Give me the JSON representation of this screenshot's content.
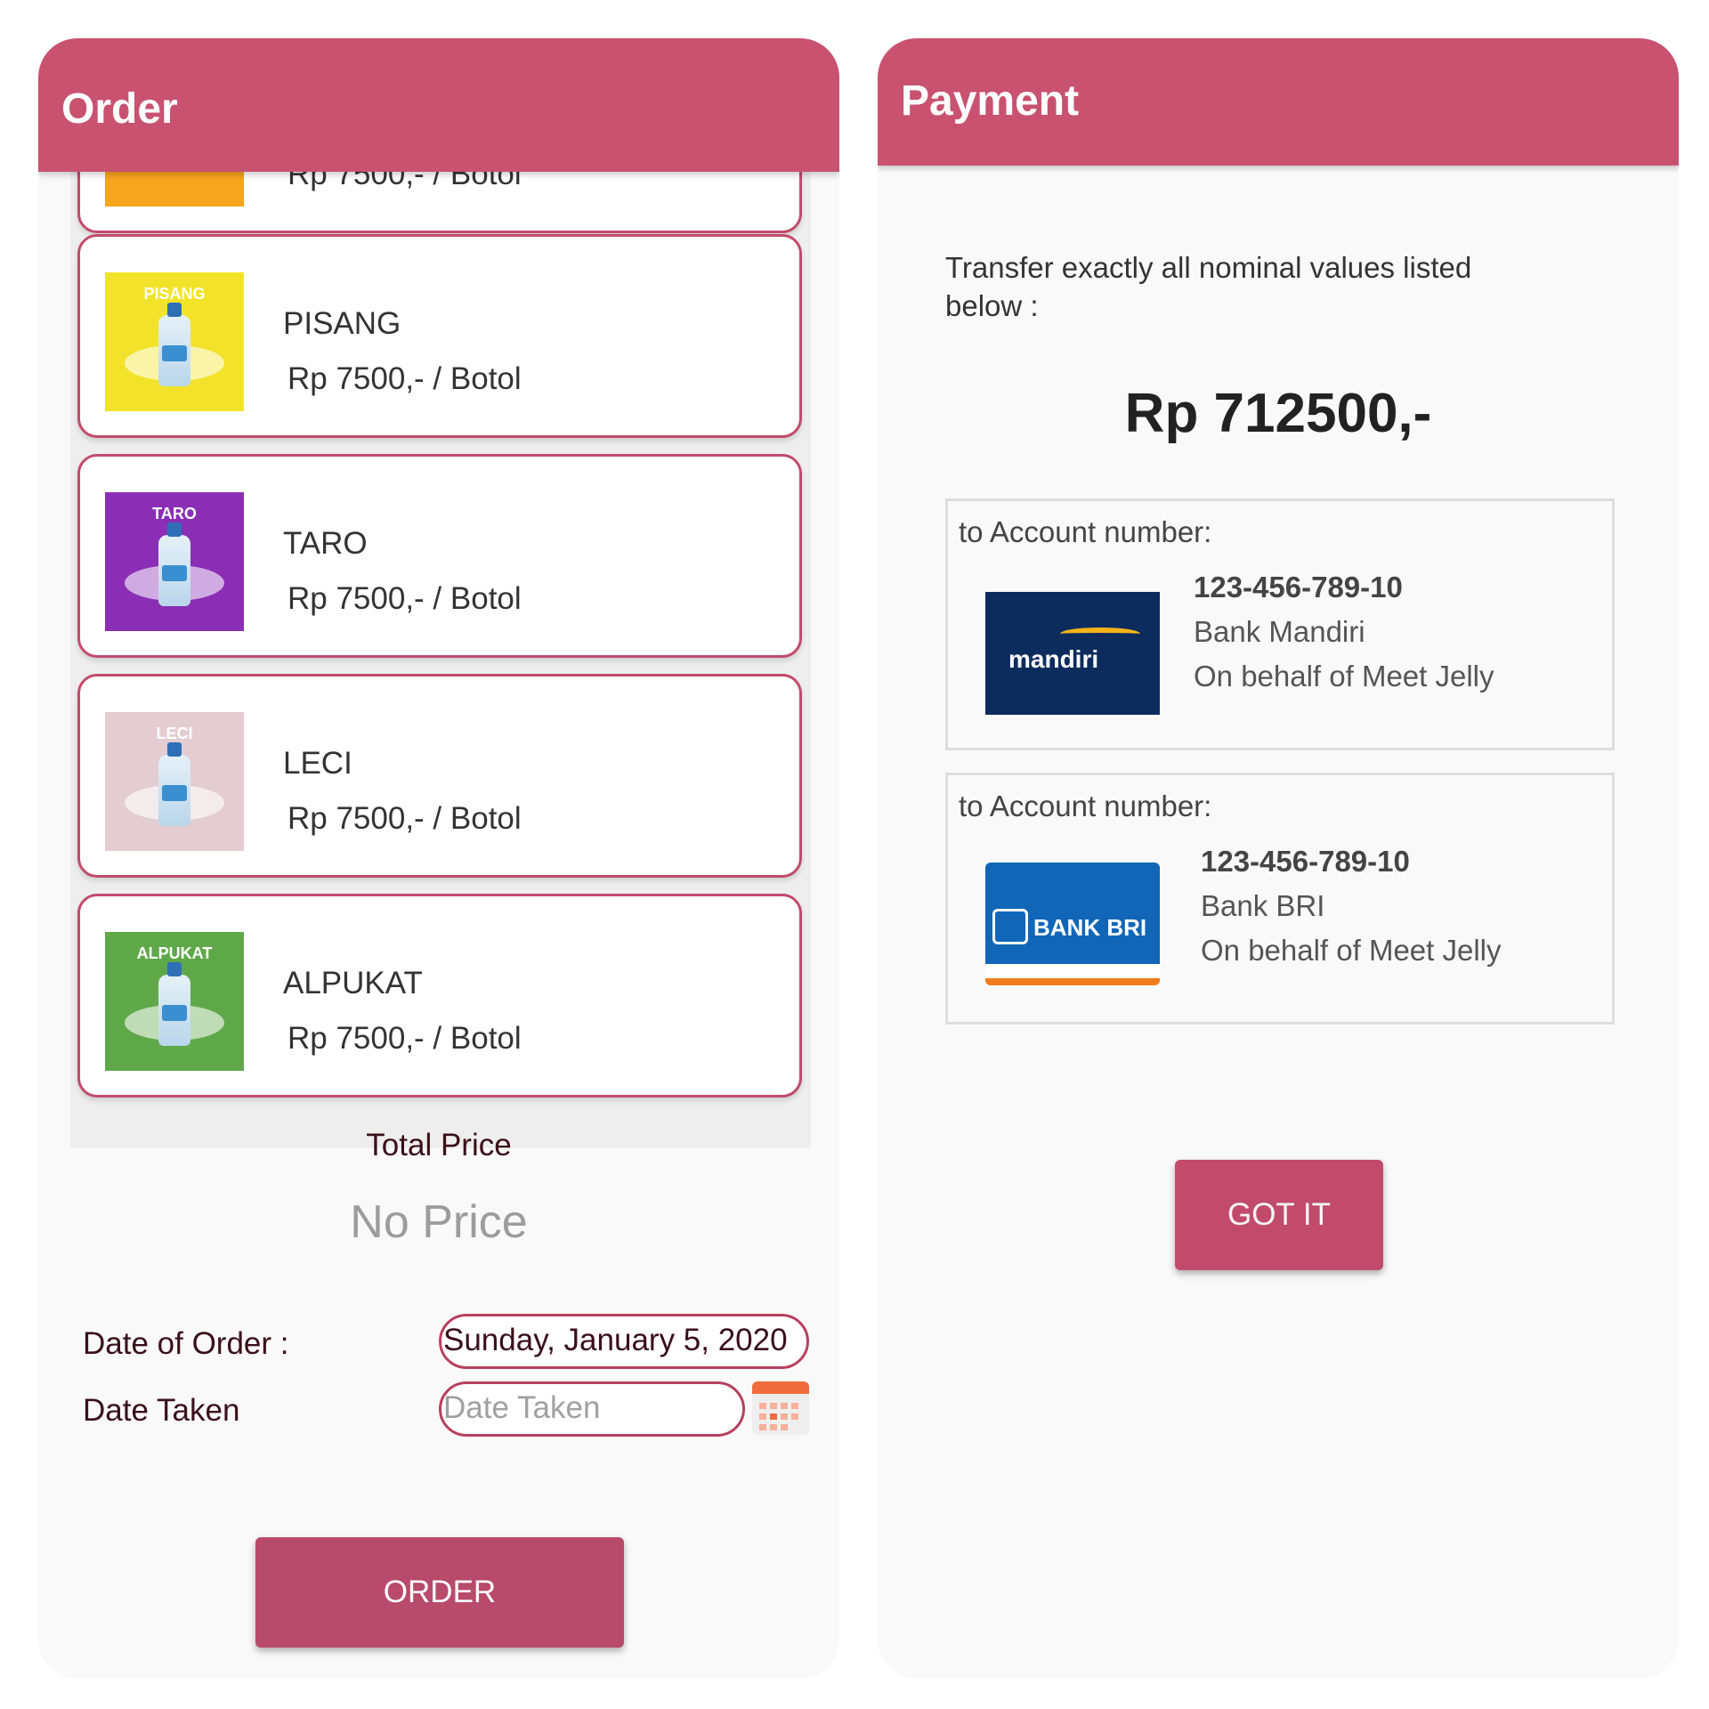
{
  "order_screen": {
    "title": "Order",
    "partial_item_price": "Rp 7500,- / Botol",
    "products": [
      {
        "image_label": "PISANG",
        "name": "PISANG",
        "price": "Rp 7500,- / Botol",
        "image_color": "#f2e32a"
      },
      {
        "image_label": "TARO",
        "name": "TARO",
        "price": "Rp 7500,- / Botol",
        "image_color": "#8a2fb5"
      },
      {
        "image_label": "LECI",
        "name": "LECI",
        "price": "Rp 7500,- / Botol",
        "image_color": "#e3cdd2"
      },
      {
        "image_label": "ALPUKAT",
        "name": "ALPUKAT",
        "price": "Rp 7500,- / Botol",
        "image_color": "#5fa84a"
      }
    ],
    "total_price_label": "Total Price",
    "total_price_value": "No Price",
    "date_of_order_label": "Date of Order :",
    "date_of_order_value": "Sunday, January 5, 2020",
    "date_taken_label": "Date Taken",
    "date_taken_placeholder": "Date Taken",
    "calendar_icon": "calendar-icon",
    "order_button": "ORDER"
  },
  "payment_screen": {
    "title": "Payment",
    "instruction": "Transfer exactly all nominal values listed below :",
    "amount": "Rp 712500,-",
    "accounts": [
      {
        "label": "to Account number:",
        "logo_text": "mandiri",
        "number": "123-456-789-10",
        "bank": "Bank Mandiri",
        "behalf": "On behalf of Meet Jelly"
      },
      {
        "label": "to Account number:",
        "logo_text": "BANK BRI",
        "number": "123-456-789-10",
        "bank": "Bank BRI",
        "behalf": "On behalf of Meet Jelly"
      }
    ],
    "got_it_button": "GOT IT"
  },
  "colors": {
    "app_bar": "#c85270",
    "button": "#b84a6b",
    "card_border": "#c24b6c"
  }
}
